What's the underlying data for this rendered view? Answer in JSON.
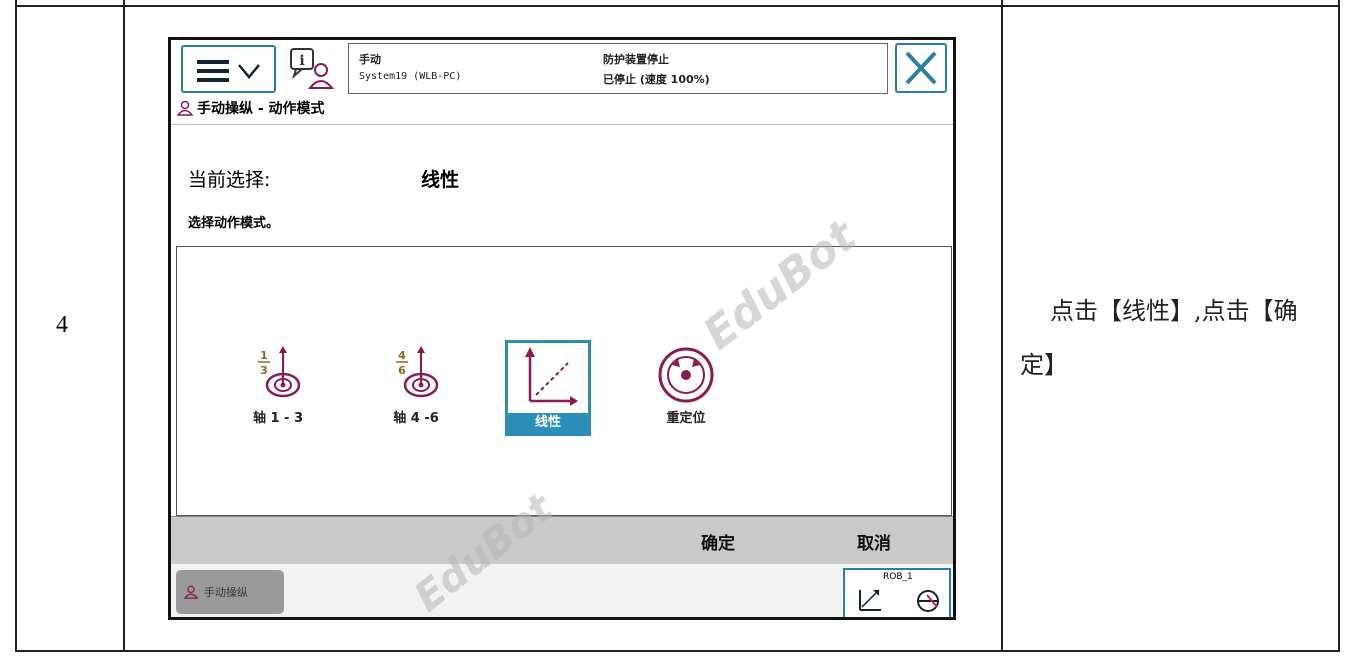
{
  "row": {
    "step_number": "4",
    "instruction": "点击【线性】,点击【确定】"
  },
  "pendant": {
    "status": {
      "mode": "手动",
      "system": "System19 (WLB-PC)",
      "safety": "防护装置停止",
      "state": "已停止 (速度 100%)"
    },
    "breadcrumb": "手动操纵 - 动作模式",
    "current_selection_label": "当前选择:",
    "current_selection_value": "线性",
    "select_mode_label": "选择动作模式。",
    "modes": [
      {
        "label": "轴 1 - 3",
        "icon": "axis-1-3-icon",
        "selected": false
      },
      {
        "label": "轴 4 -6",
        "icon": "axis-4-6-icon",
        "selected": false
      },
      {
        "label": "线性",
        "icon": "linear-icon",
        "selected": true
      },
      {
        "label": "重定位",
        "icon": "reorient-icon",
        "selected": false
      }
    ],
    "confirm_label": "确定",
    "cancel_label": "取消",
    "task_button_label": "手动操纵",
    "robot_label": "ROB_1",
    "accent_color": "#2b8fb8",
    "icon_color": "#8a1a55"
  },
  "watermark": "EduBot"
}
